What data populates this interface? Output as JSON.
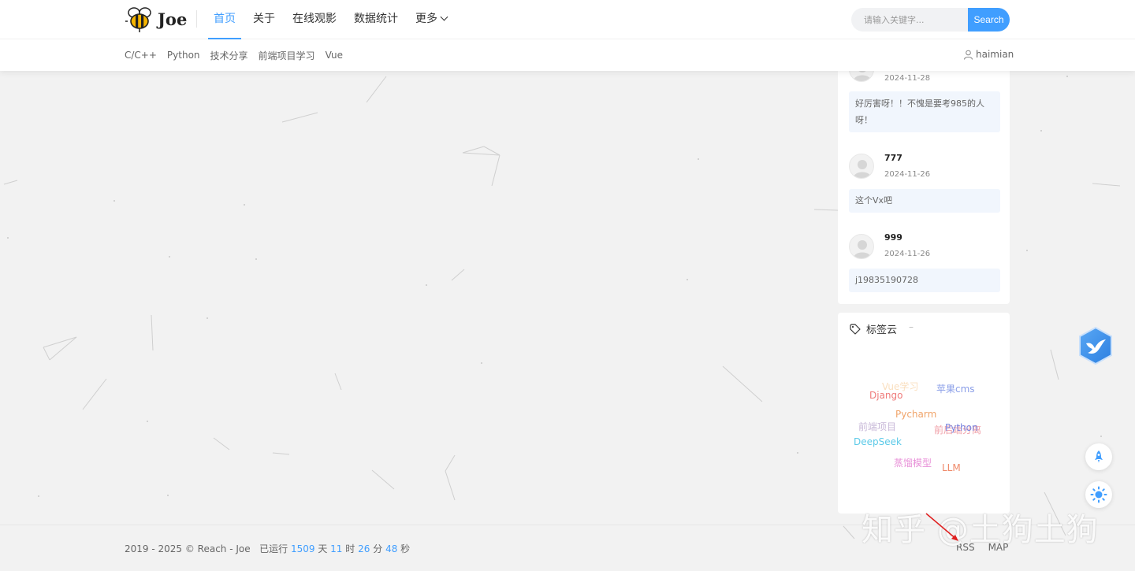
{
  "header": {
    "logo_text": "Joe",
    "nav": [
      {
        "label": "首页",
        "active": true
      },
      {
        "label": "关于"
      },
      {
        "label": "在线观影"
      },
      {
        "label": "数据统计"
      },
      {
        "label": "更多",
        "has_dropdown": true
      }
    ],
    "search": {
      "placeholder": "请输入关键字...",
      "button": "Search"
    },
    "sub_nav": [
      "C/C++",
      "Python",
      "技术分享",
      "前端项目学习",
      "Vue"
    ],
    "user": "haimian"
  },
  "comments": [
    {
      "name": "",
      "date": "2024-11-28",
      "content": "好厉害呀！！不愧是要考985的人呀！"
    },
    {
      "name": "777",
      "date": "2024-11-26",
      "content": "这个Vx吧"
    },
    {
      "name": "999",
      "date": "2024-11-26",
      "content": "j19835190728"
    }
  ],
  "tag_cloud": {
    "title": "标签云",
    "dash": "–",
    "tags": [
      {
        "label": "Vue学习",
        "color": "#f5c48a"
      },
      {
        "label": "苹果cms",
        "color": "#8a9ee8"
      },
      {
        "label": "Django",
        "color": "#ef7a7a"
      },
      {
        "label": "Pycharm",
        "color": "#f0a46a"
      },
      {
        "label": "前端项目",
        "color": "#c8b8d8"
      },
      {
        "label": "前后端分离",
        "color": "#f0a0a8"
      },
      {
        "label": "Python",
        "color": "#7a86e0"
      },
      {
        "label": "DeepSeek",
        "color": "#5ccae8"
      },
      {
        "label": "蒸馏模型",
        "color": "#e890d8"
      },
      {
        "label": "LLM",
        "color": "#ef8a6a"
      }
    ]
  },
  "footer": {
    "copyright": "2019 - 2025 © Reach - Joe",
    "running_prefix": "已运行",
    "days": "1509",
    "days_unit": "天",
    "hours": "11",
    "hours_unit": "时",
    "minutes": "26",
    "minutes_unit": "分",
    "seconds": "48",
    "seconds_unit": "秒",
    "links": [
      "RSS",
      "MAP"
    ]
  },
  "watermark": "知乎 @土狗土狗",
  "colors": {
    "accent": "#409eff",
    "background": "#f2f2f2"
  }
}
